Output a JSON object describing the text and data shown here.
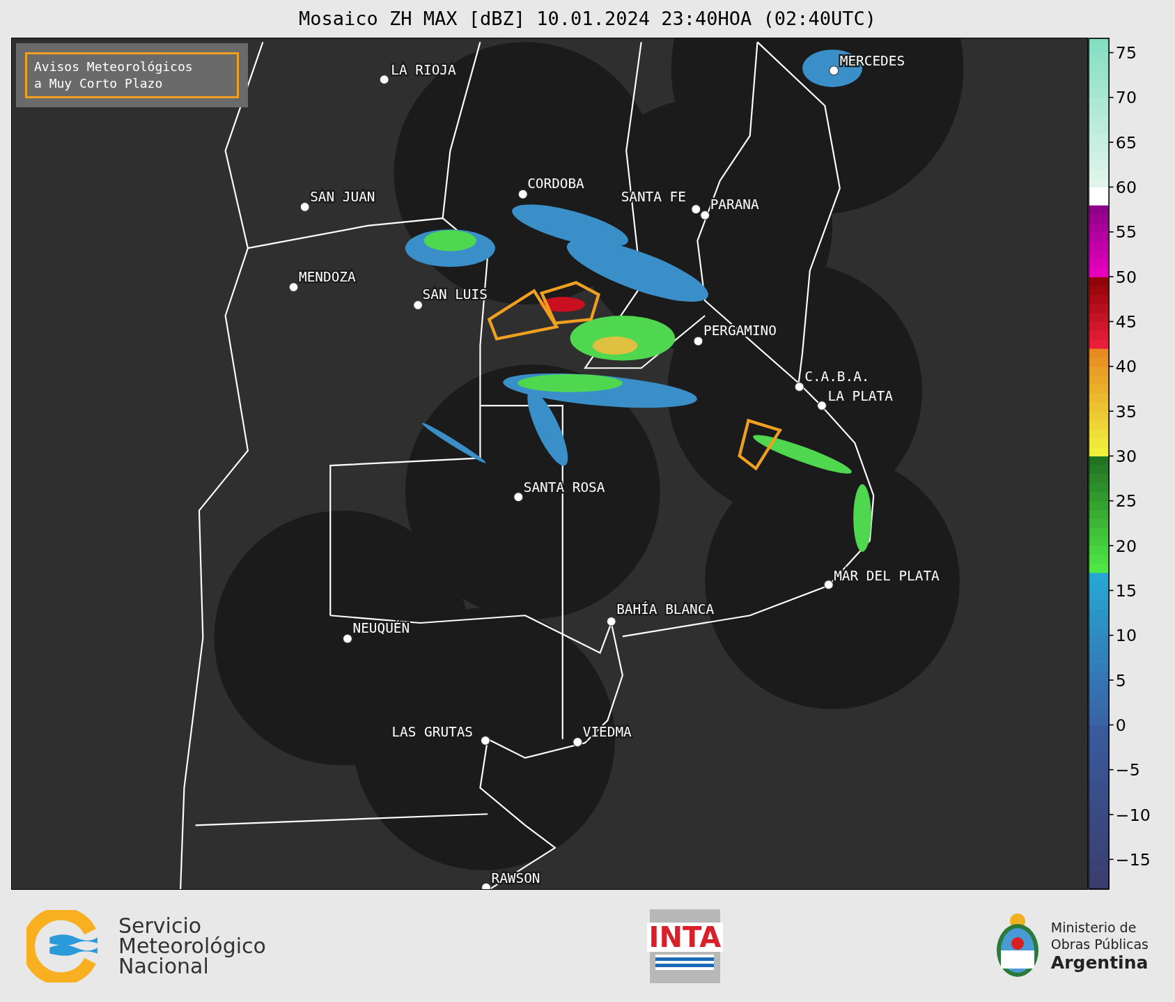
{
  "title": "Mosaico ZH MAX [dBZ] 10.01.2024 23:40HOA (02:40UTC)",
  "map": {
    "warning_legend": [
      "Avisos Meteorológicos",
      "a Muy Corto Plazo"
    ],
    "cities": [
      {
        "name": "LA RIOJA"
      },
      {
        "name": "SAN JUAN"
      },
      {
        "name": "MENDOZA"
      },
      {
        "name": "SAN LUIS"
      },
      {
        "name": "CORDOBA"
      },
      {
        "name": "SANTA FE"
      },
      {
        "name": "PARANA"
      },
      {
        "name": "MERCEDES"
      },
      {
        "name": "PERGAMINO"
      },
      {
        "name": "C.A.B.A."
      },
      {
        "name": "LA PLATA"
      },
      {
        "name": "SANTA ROSA"
      },
      {
        "name": "MAR DEL PLATA"
      },
      {
        "name": "BAHÍA BLANCA"
      },
      {
        "name": "NEUQUÉN"
      },
      {
        "name": "LAS GRUTAS"
      },
      {
        "name": "VIEDMA"
      },
      {
        "name": "RAWSON"
      }
    ]
  },
  "colorbar": {
    "ticks": [
      "75",
      "70",
      "65",
      "60",
      "55",
      "50",
      "45",
      "40",
      "35",
      "30",
      "25",
      "20",
      "15",
      "10",
      "5",
      "0",
      "−5",
      "−10",
      "−15"
    ]
  },
  "footer": {
    "smn": [
      "Servicio",
      "Meteorológico",
      "Nacional"
    ],
    "inta": "INTA",
    "ministry": [
      "Ministerio de",
      "Obras Públicas",
      "Argentina"
    ]
  }
}
